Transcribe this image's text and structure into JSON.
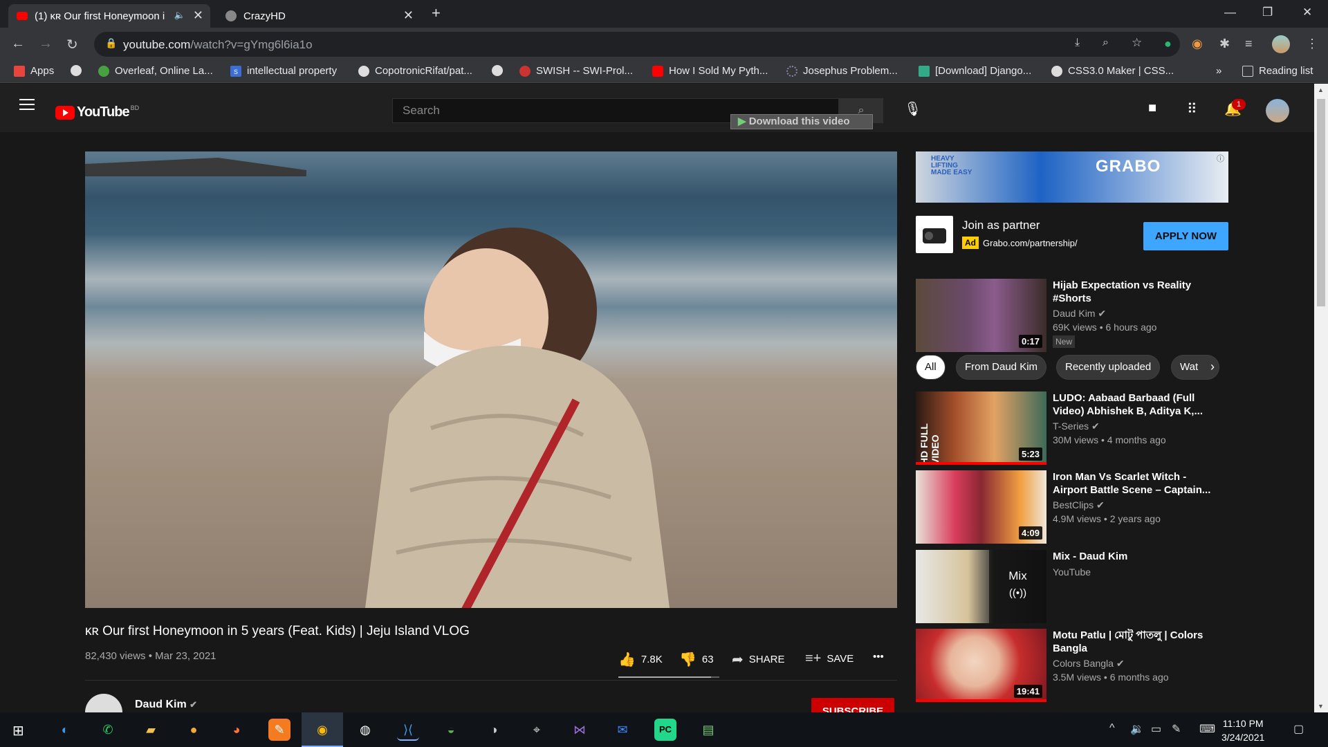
{
  "tabs": [
    {
      "title": "(1) ᴋʀ Our first Honeymoon i",
      "active": true
    },
    {
      "title": "CrazyHD",
      "active": false
    }
  ],
  "window_controls": {
    "minimize": "—",
    "maximize": "❐",
    "close": "✕"
  },
  "url": {
    "host": "youtube.com",
    "path": "/watch?v=gYmg6l6ia1o"
  },
  "bookmarks": [
    "Apps",
    "Overleaf, Online La...",
    "intellectual property",
    "CopotronicRifat/pat...",
    "SWISH -- SWI-Prol...",
    "How I Sold My Pyth...",
    "Josephus Problem...",
    "[Download] Django...",
    "CSS3.0 Maker | CSS..."
  ],
  "bookmarks_overflow": "»",
  "reading_list": "Reading list",
  "youtube": {
    "logo_text": "YouTube",
    "region": "BD",
    "search_placeholder": "Search",
    "download_overlay": "Download this video",
    "notification_count": "1"
  },
  "video": {
    "title": "ᴋʀ Our first Honeymoon in 5 years (Feat. Kids) | Jeju Island VLOG",
    "views_date": "82,430 views • Mar 23, 2021",
    "likes": "7.8K",
    "dislikes": "63",
    "like_ratio": 0.92,
    "share_label": "SHARE",
    "save_label": "SAVE",
    "more": "•••",
    "channel": "Daud Kim",
    "subscribe_label": "SUBSCRIBE"
  },
  "ad": {
    "brand": "GRABO",
    "tagline": "HEAVY LIFTING MADE EASY",
    "title": "Join as partner",
    "badge": "Ad",
    "domain": "Grabo.com/partnership/",
    "cta": "APPLY NOW"
  },
  "chips": [
    "All",
    "From Daud Kim",
    "Recently uploaded",
    "Wat"
  ],
  "recommendations": [
    {
      "title": "Hijab Expectation vs Reality #Shorts",
      "channel": "Daud Kim",
      "meta": "69K views • 6 hours ago",
      "duration": "0:17",
      "badge": "New"
    },
    {
      "title": "LUDO: Aabaad Barbaad (Full Video) Abhishek B, Aditya K,...",
      "channel": "T-Series",
      "meta": "30M views • 4 months ago",
      "duration": "5:23"
    },
    {
      "title": "Iron Man Vs Scarlet Witch - Airport Battle Scene – Captain...",
      "channel": "BestClips",
      "meta": "4.9M views • 2 years ago",
      "duration": "4:09"
    },
    {
      "title": "Mix - Daud Kim",
      "channel": "YouTube",
      "meta": "",
      "duration": "",
      "mix_label": "Mix"
    },
    {
      "title": "Motu Patlu | মোটু পাতলু | Colors Bangla",
      "channel": "Colors Bangla",
      "meta": "3.5M views • 6 months ago",
      "duration": "19:41"
    }
  ],
  "taskbar": {
    "time": "11:10 PM",
    "date": "3/24/2021"
  },
  "colors": {
    "yt_red": "#ff0000",
    "apply_blue": "#3ea6ff",
    "subscribe_red": "#cc0000"
  }
}
